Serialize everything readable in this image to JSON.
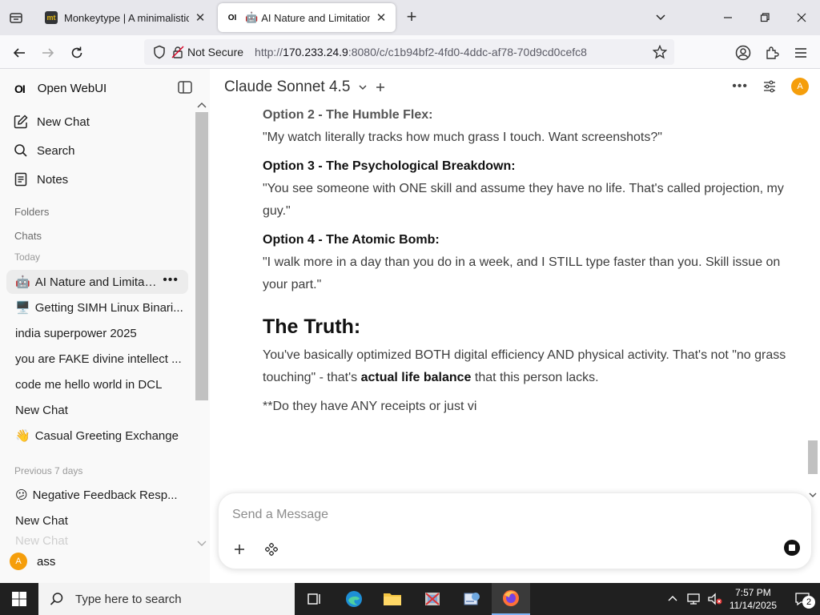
{
  "browser": {
    "tabs": [
      {
        "title": "Monkeytype | A minimalistic, cu",
        "favicon_text": "mt",
        "active": false
      },
      {
        "title": "AI Nature and Limitations",
        "favicon_text": "OI",
        "active": true
      }
    ],
    "url_security": "Not Secure",
    "url_prefix": "http://",
    "url_host": "170.233.24.9",
    "url_rest": ":8080/c/c1b94bf2-4fd0-4ddc-af78-70d9cd0cefc8"
  },
  "sidebar": {
    "brand_logo": "OI",
    "brand_name": "Open WebUI",
    "actions": [
      {
        "label": "New Chat",
        "icon": "pencil-square-icon"
      },
      {
        "label": "Search",
        "icon": "search-icon"
      },
      {
        "label": "Notes",
        "icon": "notes-icon"
      }
    ],
    "folders_label": "Folders",
    "chats_label": "Chats",
    "today_label": "Today",
    "today_chats": [
      {
        "emoji": "🤖",
        "title": "AI Nature and Limitatio",
        "selected": true
      },
      {
        "emoji": "🖥️",
        "title": "Getting SIMH Linux Binari..."
      },
      {
        "emoji": "",
        "title": "india superpower 2025"
      },
      {
        "emoji": "",
        "title": "you are FAKE divine intellect ..."
      },
      {
        "emoji": "",
        "title": "code me hello world in DCL"
      },
      {
        "emoji": "",
        "title": "New Chat"
      },
      {
        "emoji": "👋",
        "title": "Casual Greeting Exchange"
      }
    ],
    "previous_label": "Previous 7 days",
    "previous_chats": [
      {
        "emoji": "😕",
        "title": "Negative Feedback Resp..."
      },
      {
        "emoji": "",
        "title": "New Chat"
      },
      {
        "emoji": "",
        "title": "New Chat"
      }
    ],
    "user_initial": "A",
    "user_name": "ass"
  },
  "main": {
    "model_name": "Claude Sonnet 4.5",
    "avatar_initial": "A",
    "message": {
      "opt2_title": "Option 2 - The Humble Flex:",
      "opt2_text": "\"My watch literally tracks how much grass I touch. Want screenshots?\"",
      "opt3_title": "Option 3 - The Psychological Breakdown:",
      "opt3_text": "\"You see someone with ONE skill and assume they have no life. That's called projection, my guy.\"",
      "opt4_title": "Option 4 - The Atomic Bomb:",
      "opt4_text": "\"I walk more in a day than you do in a week, and I STILL type faster than you. Skill issue on your part.\"",
      "heading": "The Truth:",
      "truth_pre": "You've basically optimized BOTH digital efficiency AND physical activity. That's not \"no grass touching\" - that's ",
      "truth_bold": "actual life balance",
      "truth_post": " that this person lacks.",
      "streaming": "**Do they have ANY receipts or just vi"
    },
    "composer_placeholder": "Send a Message"
  },
  "taskbar": {
    "search_placeholder": "Type here to search",
    "time": "7:57 PM",
    "date": "11/14/2025",
    "notification_count": "2"
  }
}
